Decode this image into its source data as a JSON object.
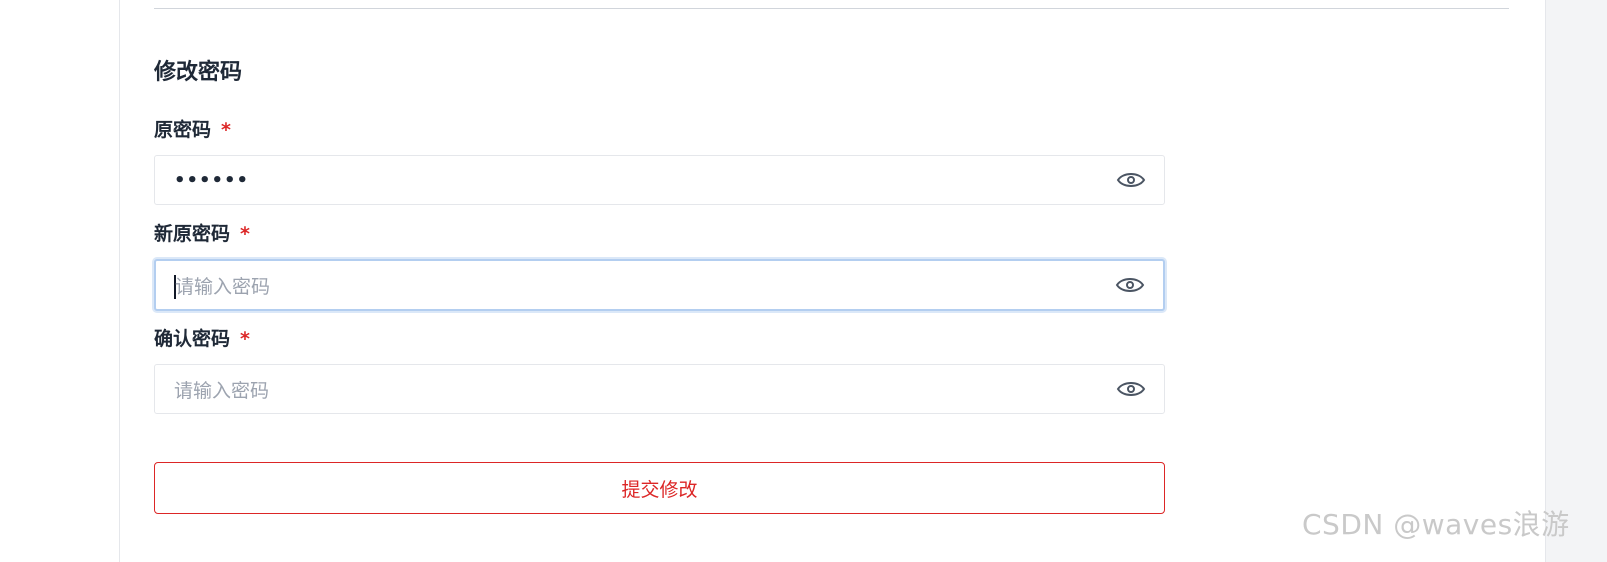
{
  "form": {
    "title": "修改密码",
    "required_mark": "*",
    "fields": [
      {
        "label": "原密码",
        "value": "••••••",
        "placeholder": ""
      },
      {
        "label": "新原密码",
        "value": "",
        "placeholder": "请输入密码"
      },
      {
        "label": "确认密码",
        "value": "",
        "placeholder": "请输入密码"
      }
    ],
    "submit_label": "提交修改"
  },
  "icons": {
    "visibility_toggle": "eye-icon"
  },
  "colors": {
    "required": "#dc2626",
    "submit_border": "#dc2626",
    "focus_ring": "#b3cef0"
  },
  "watermark": "CSDN @waves浪游"
}
